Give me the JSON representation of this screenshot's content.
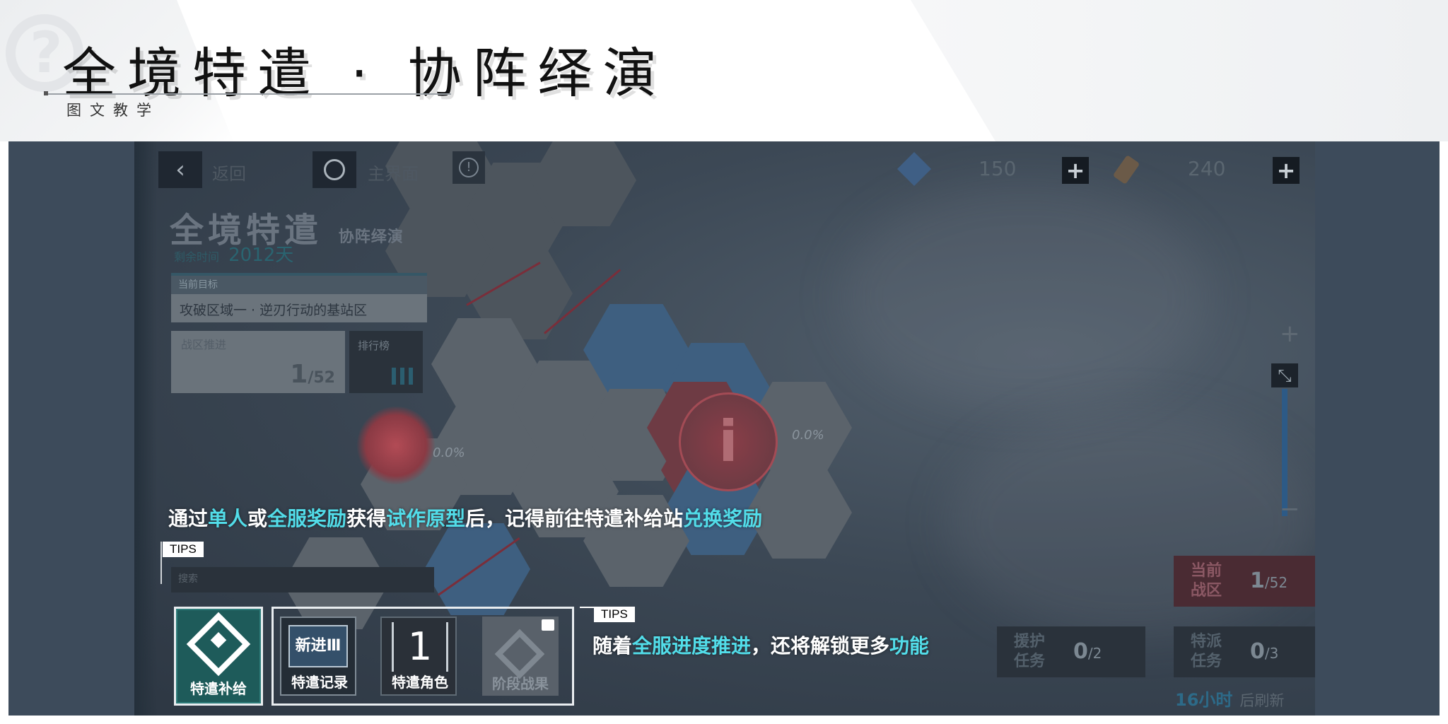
{
  "header": {
    "title": "全境特遣 · 协阵绎演",
    "subtitle": "图文教学"
  },
  "game": {
    "topbar": {
      "back_label": "返回",
      "home_label": "主界面",
      "resource1_value": "150",
      "resource2_value": "240"
    },
    "stage": {
      "title": "全境特遣",
      "title_suffix": "协阵绎演",
      "time_label": "剩余时间",
      "time_value": "2012天"
    },
    "goal": {
      "label": "当前目标",
      "value": "攻破区域一 · 逆刃行动的基站区"
    },
    "progress": {
      "label": "战区推进",
      "current": "1",
      "total": "/52"
    },
    "rank_button_label": "排行榜",
    "map_percent_1": "0.0%",
    "map_percent_2": "0.0%",
    "search_placeholder": "搜索",
    "stats": {
      "current_zone": {
        "label": "当前战区",
        "value": "1",
        "total": "/52"
      },
      "support_task": {
        "label": "援护任务",
        "value": "0",
        "total": "/2"
      },
      "dispatch_task": {
        "label": "特派任务",
        "value": "0",
        "total": "/3"
      }
    },
    "refresh": {
      "hours": "16小时",
      "suffix": "后刷新"
    },
    "features": {
      "supply": "特遣补给",
      "record": "特遣记录",
      "record_icon_text": "新进Ⅲ",
      "role": "特遣角色",
      "role_icon_text": "1",
      "stage_result": "阶段战果"
    }
  },
  "tips": {
    "tag": "TIPS",
    "tip1": {
      "p1": "通过",
      "h1": "单人",
      "p2": "或",
      "h2": "全服奖励",
      "p3": "获得",
      "h3": "试作原型",
      "p4": "后，记得前往特遣补给站",
      "h4": "兑换奖励"
    },
    "tip2": {
      "p1": "随着",
      "h1": "全服进度推进",
      "p2": "，还将解锁更多",
      "h2": "功能"
    }
  },
  "colors": {
    "highlight": "#52dde9",
    "panel_bg": "#3a4858"
  },
  "icons": [
    "back-arrow-icon",
    "home-circle-icon",
    "info-icon",
    "dice-resource-icon",
    "flask-resource-icon",
    "plus-icon",
    "zoom-plus-icon",
    "zoom-fit-icon",
    "zoom-minus-icon",
    "supply-diamond-icon",
    "lock-icon"
  ]
}
